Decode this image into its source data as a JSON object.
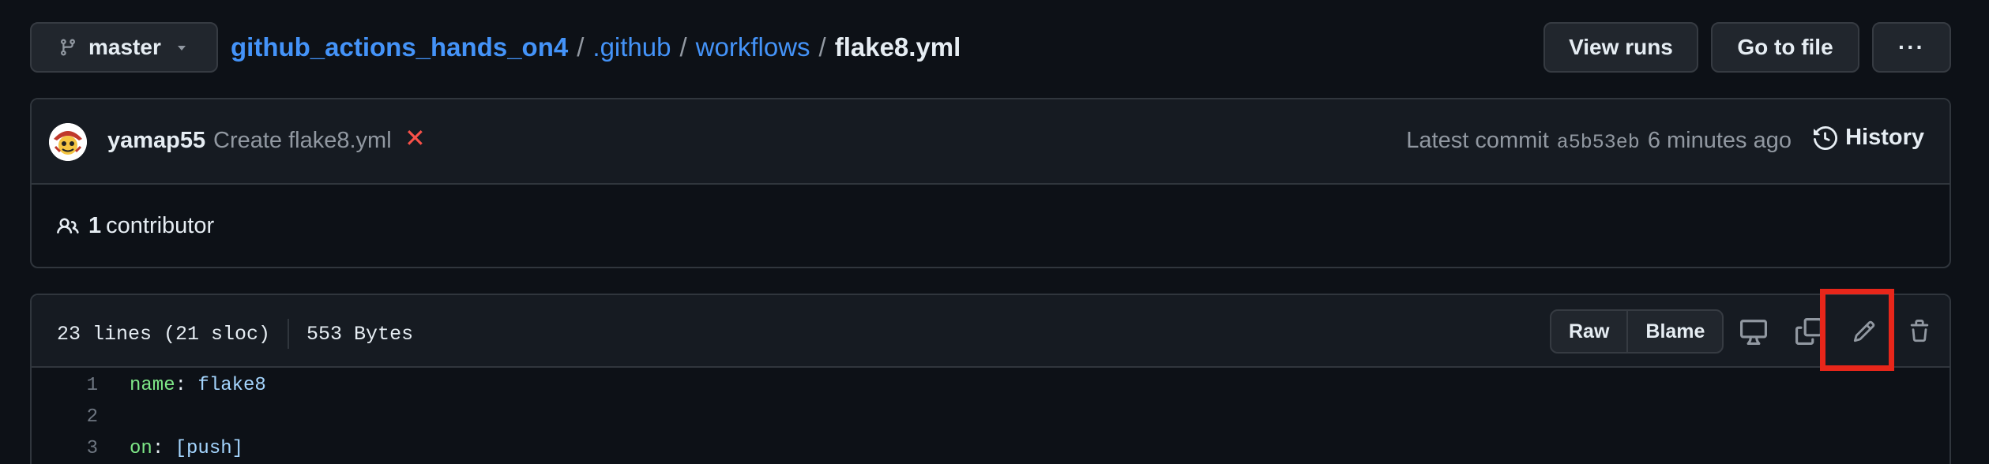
{
  "header": {
    "branch": "master",
    "breadcrumb": {
      "repo": "github_actions_hands_on4",
      "dir1": ".github",
      "dir2": "workflows",
      "file": "flake8.yml",
      "separator": "/"
    },
    "buttons": {
      "view_runs": "View runs",
      "go_to_file": "Go to file",
      "more": "···"
    }
  },
  "commit": {
    "author": "yamap55",
    "message": "Create flake8.yml",
    "status_icon": "✕",
    "latest_label": "Latest commit",
    "sha": "a5b53eb",
    "time": "6 minutes ago",
    "history_label": "History",
    "contributors_count": "1",
    "contributors_label": "contributor"
  },
  "file": {
    "lines_info": "23 lines (21 sloc)",
    "size": "553 Bytes",
    "raw_label": "Raw",
    "blame_label": "Blame",
    "icons": [
      "display-icon",
      "copy-icon",
      "pencil-icon",
      "trash-icon"
    ]
  },
  "code_lines": [
    {
      "num": "1",
      "key": "name",
      "colon": ":",
      "value": " flake8"
    },
    {
      "num": "2",
      "key": "",
      "colon": "",
      "value": ""
    },
    {
      "num": "3",
      "key": "on",
      "colon": ":",
      "value": " [push]"
    }
  ],
  "colors": {
    "background": "#0d1117",
    "link": "#4493f8",
    "highlight": "#e8261a",
    "error": "#f85149",
    "yaml_key": "#7ee787",
    "yaml_value": "#a5d6ff"
  }
}
